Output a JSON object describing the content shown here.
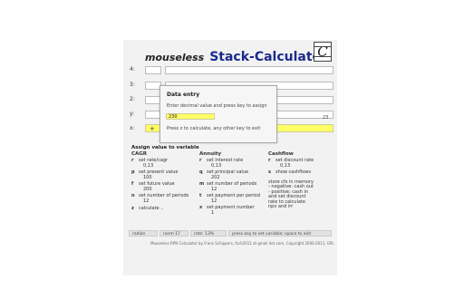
{
  "header": {
    "title_prefix": "mouseless",
    "title_main": "Stack-Calculator",
    "logo_glyph": "C"
  },
  "stack": {
    "labels": [
      "4:",
      "3:",
      "2:",
      "y:",
      "x:"
    ],
    "x_prefix": "+",
    "counter": "23"
  },
  "modal": {
    "title": "Data entry",
    "description": "Enter decimal value and press key to assign",
    "input_value": "230",
    "hint": "Press z to calculate, any other key to exit"
  },
  "assign": {
    "title": "Assign value to variable",
    "cagr": {
      "heading": "CAGR",
      "items": [
        {
          "key": "r",
          "desc": "set rate/cagr",
          "value": "0,13"
        },
        {
          "key": "p",
          "desc": "set present value",
          "value": "100"
        },
        {
          "key": "f",
          "desc": "set future value",
          "value": "200"
        },
        {
          "key": "n",
          "desc": "set number of periods",
          "value": "12"
        },
        {
          "key": "z",
          "desc": "calculate ..",
          "value": ""
        }
      ]
    },
    "annuity": {
      "heading": "Annuity",
      "items": [
        {
          "key": "r",
          "desc": "set interest rate",
          "value": "0,13"
        },
        {
          "key": "q",
          "desc": "set principal value",
          "value": "202"
        },
        {
          "key": "m",
          "desc": "set number of periods",
          "value": "12"
        },
        {
          "key": "t",
          "desc": "set payment per period",
          "value": "12"
        },
        {
          "key": "x",
          "desc": "set payment number",
          "value": "1"
        }
      ]
    },
    "cashflow": {
      "heading": "Cashflow",
      "items": [
        {
          "key": "r",
          "desc": "set discount rate",
          "value": "0,13"
        },
        {
          "key": "s",
          "desc": "show cashflows",
          "value": ""
        }
      ],
      "notes": [
        "store cfs in memory",
        "- negative: cash out",
        "- positive: cash in",
        "and set discount",
        "rate to calculate",
        "npv and irr"
      ]
    }
  },
  "status": {
    "mode": "radian",
    "norm": "norm 17",
    "rate": "rate: 13%",
    "hint": "press key to set variable; space to exit"
  },
  "footer": "Mouseless RPN Calculator by Frans Schippers, fsch2011 at gmail dot com, Copyright 2006-2011, GPL",
  "colors": {
    "accent_yellow": "#ffff66",
    "title_blue": "#1a2a8a"
  }
}
